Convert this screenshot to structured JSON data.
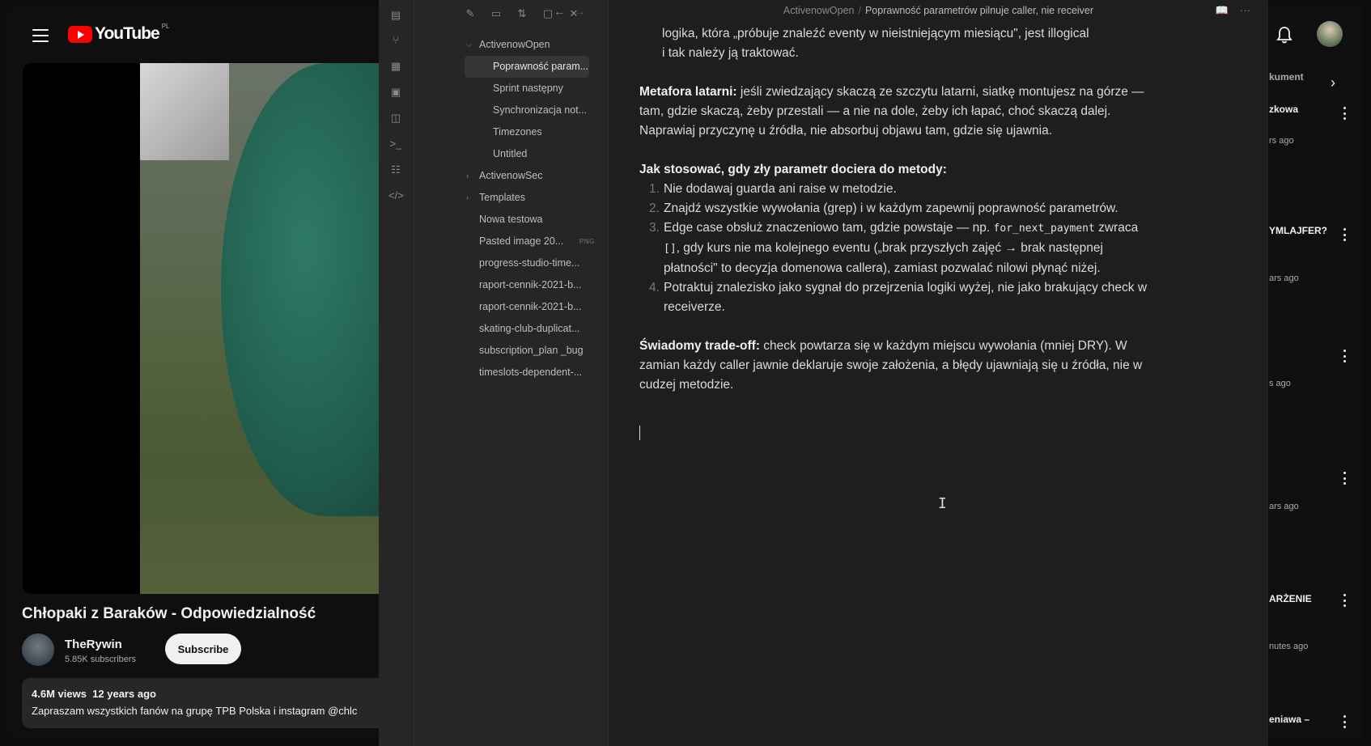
{
  "youtube": {
    "logo_text": "YouTube",
    "region": "PL",
    "video_title": "Chłopaki z Baraków - Odpowiedzialność",
    "channel": "TheRywin",
    "subscribers": "5.85K subscribers",
    "subscribe_label": "Subscribe",
    "views": "4.6M views",
    "age": "12 years ago",
    "description": "Zapraszam wszystkich fanów na grupę TPB Polska i instagram @chlc",
    "recommended": [
      {
        "title": "kument",
        "meta": ""
      },
      {
        "title": "zkowa",
        "meta": "rs ago"
      },
      {
        "title": "YMLAJFER?",
        "meta": "ars ago"
      },
      {
        "title": "",
        "meta": "s ago"
      },
      {
        "title": "",
        "meta": "ars ago"
      },
      {
        "title": "ARŻENIE",
        "meta": "nutes ago"
      },
      {
        "title": "eniawa –",
        "meta": ""
      }
    ]
  },
  "obsidian": {
    "breadcrumb": {
      "root": "ActivenowOpen",
      "separator": "/",
      "current": "Poprawność parametrów pilnuje caller, nie receiver"
    },
    "tree": [
      {
        "label": "ActivenowOpen",
        "level": 0,
        "caret": "⌵"
      },
      {
        "label": "Poprawność param...",
        "level": 1,
        "selected": true
      },
      {
        "label": "Sprint następny",
        "level": 1
      },
      {
        "label": "Synchronizacja not...",
        "level": 1
      },
      {
        "label": "Timezones",
        "level": 1
      },
      {
        "label": "Untitled",
        "level": 1
      },
      {
        "label": "ActivenowSec",
        "level": 0,
        "caret": "›"
      },
      {
        "label": "Templates",
        "level": 0,
        "caret": "›"
      },
      {
        "label": "Nowa testowa",
        "level": 0
      },
      {
        "label": "Pasted image 20...",
        "level": 0,
        "badge": "PNG"
      },
      {
        "label": "progress-studio-time...",
        "level": 0
      },
      {
        "label": "raport-cennik-2021-b...",
        "level": 0
      },
      {
        "label": "raport-cennik-2021-b...",
        "level": 0
      },
      {
        "label": "skating-club-duplicat...",
        "level": 0
      },
      {
        "label": "subscription_plan _bug",
        "level": 0
      },
      {
        "label": "timeslots-dependent-...",
        "level": 0
      }
    ],
    "doc": {
      "p0_line1": "logika, która „próbuje znaleźć eventy w nieistniejącym miesiącu\", jest illogical",
      "p0_line2": "i tak należy ją traktować.",
      "p1_bold": "Metafora latarni:",
      "p1_text": " jeśli zwiedzający skaczą ze szczytu latarni, siatkę montujesz na górze — tam, gdzie skaczą, żeby przestali — a nie na dole, żeby ich łapać, choć skaczą dalej. Naprawiaj przyczynę u źródła, nie absorbuj objawu tam, gdzie się ujawnia.",
      "p2_bold": "Jak stosować, gdy zły parametr dociera do metody:",
      "list": [
        {
          "num": "1.",
          "text": "Nie dodawaj guarda ani raise w metodzie."
        },
        {
          "num": "2.",
          "text": "Znajdź wszystkie wywołania (grep) i w każdym zapewnij poprawność parametrów."
        },
        {
          "num": "3.",
          "pre": "Edge case obsłuż znaczeniowo tam, gdzie powstaje — np. ",
          "code1": "for_next_payment",
          "mid": " zwraca ",
          "code2": "[]",
          "post": ", gdy kurs nie ma kolejnego eventu („brak przyszłych zajęć → brak następnej płatności\" to decyzja domenowa callera), zamiast pozwalać nilowi płynąć niżej."
        },
        {
          "num": "4.",
          "text": "Potraktuj znalezisko jako sygnał do przejrzenia logiki wyżej, nie jako brakujący check w receiverze."
        }
      ],
      "p3_bold": "Świadomy trade-off:",
      "p3_text": " check powtarza się w każdym miejscu wywołania (mniej DRY). W zamian każdy caller jawnie deklaruje swoje założenia, a błędy ujawniają się u źródła, nie w cudzej metodzie."
    }
  }
}
